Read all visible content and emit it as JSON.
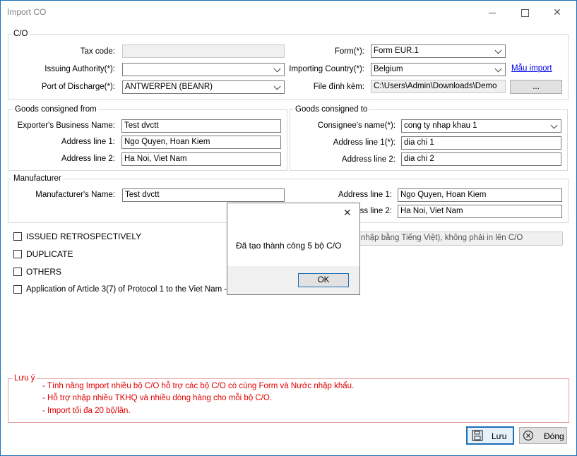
{
  "window": {
    "title": "Import CO",
    "minimize": "—",
    "maximize": "☐",
    "close": "✕"
  },
  "co_group": {
    "legend": "C/O",
    "tax_code_label": "Tax code:",
    "tax_code_value": "",
    "issuing_authority_label": "Issuing Authority(*):",
    "issuing_authority_value": "",
    "port_label": "Port of Discharge(*):",
    "port_value": "ANTWERPEN (BEANR)",
    "form_label": "Form(*):",
    "form_value": "Form EUR.1",
    "importing_country_label": "Importing Country(*):",
    "importing_country_value": "Belgium",
    "template_link": "Mẫu import",
    "attachment_label": "File đính kèm:",
    "attachment_value": "C:\\Users\\Admin\\Downloads\\Demo",
    "browse_label": "..."
  },
  "consigned_from": {
    "legend": "Goods consigned from",
    "business_name_label": "Exporter's Business Name:",
    "business_name_value": "Test dvctt",
    "addr1_label": "Address line 1:",
    "addr1_value": "Ngo Quyen, Hoan Kiem",
    "addr2_label": "Address line 2:",
    "addr2_value": "Ha Noi, Viet Nam"
  },
  "consigned_to": {
    "legend": "Goods consigned to",
    "consignee_label": "Consignee's name(*):",
    "consignee_value": "cong ty nhap khau 1",
    "addr1_label": "Address line 1(*):",
    "addr1_value": "dia chi 1",
    "addr2_label": "Address line 2:",
    "addr2_value": "dia chi 2"
  },
  "manufacturer": {
    "legend": "Manufacturer",
    "name_label": "Manufacturer's Name:",
    "name_value": "Test dvctt",
    "addr1_label": "Address line 1:",
    "addr1_value": "Ngo Quyen, Hoan Kiem",
    "addr2_label": "ess line 2:",
    "addr2_value": "Ha Noi, Viet Nam"
  },
  "options": [
    {
      "label": "ISSUED RETROSPECTIVELY",
      "checked": false
    },
    {
      "label": "DUPLICATE",
      "checked": false
    },
    {
      "label": "OTHERS",
      "checked": false
    },
    {
      "label": "Application of Article 3(7) of Protocol 1 to the Viet Nam - EU",
      "checked": false
    }
  ],
  "remark_placeholder": "nhập bằng Tiếng Việt), không phải in lên C/O",
  "notes": {
    "legend": "Lưu ý",
    "lines": [
      "- Tính năng Import nhiều bộ C/O hỗ trợ các bộ C/O có cùng Form và Nước nhập khẩu.",
      "- Hỗ trợ nhập nhiều TKHQ và nhiều dòng hàng cho mỗi bộ C/O.",
      "- Import tối đa 20 bộ/lần."
    ]
  },
  "buttons": {
    "save": "Lưu",
    "close": "Đóng"
  },
  "dialog": {
    "message": "Đã tạo thành công 5 bộ C/O",
    "ok": "OK",
    "close": "✕"
  },
  "colors": {
    "accent": "#1d6fb8",
    "note_red": "#e00000",
    "link": "#0000ee"
  }
}
